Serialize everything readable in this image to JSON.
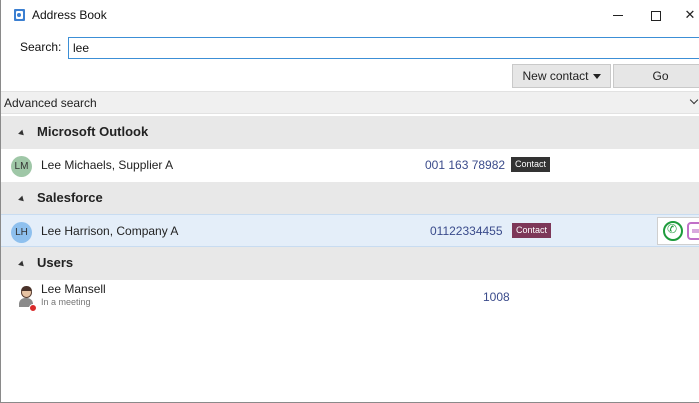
{
  "window": {
    "title": "Address Book",
    "minimize_icon": "minimize-icon",
    "maximize_icon": "maximize-icon",
    "close_glyph": "✕"
  },
  "search": {
    "label": "Search:",
    "value": "lee"
  },
  "toolbar": {
    "new_contact_label": "New contact",
    "go_label": "Go"
  },
  "advanced_search": {
    "label": "Advanced search"
  },
  "groups": [
    {
      "label": "Microsoft Outlook",
      "rows": [
        {
          "initials": "LM",
          "name": "Lee Michaels, Supplier A",
          "phone": "001 163 78982",
          "badge": "Contact"
        }
      ]
    },
    {
      "label": "Salesforce",
      "rows": [
        {
          "initials": "LH",
          "name": "Lee Harrison, Company A",
          "phone": "01122334455",
          "badge": "Contact"
        }
      ]
    },
    {
      "label": "Users",
      "rows": [
        {
          "name": "Lee Mansell",
          "status": "In a meeting",
          "extension": "1008"
        }
      ]
    }
  ],
  "colors": {
    "accent": "#3c8fd6",
    "selected_row": "#e4eef9",
    "badge_outlook": "#333333",
    "badge_salesforce": "#7d3758",
    "phone_text": "#3a4b8b",
    "call_green": "#1e9b3c",
    "status_busy": "#d92b2b"
  }
}
